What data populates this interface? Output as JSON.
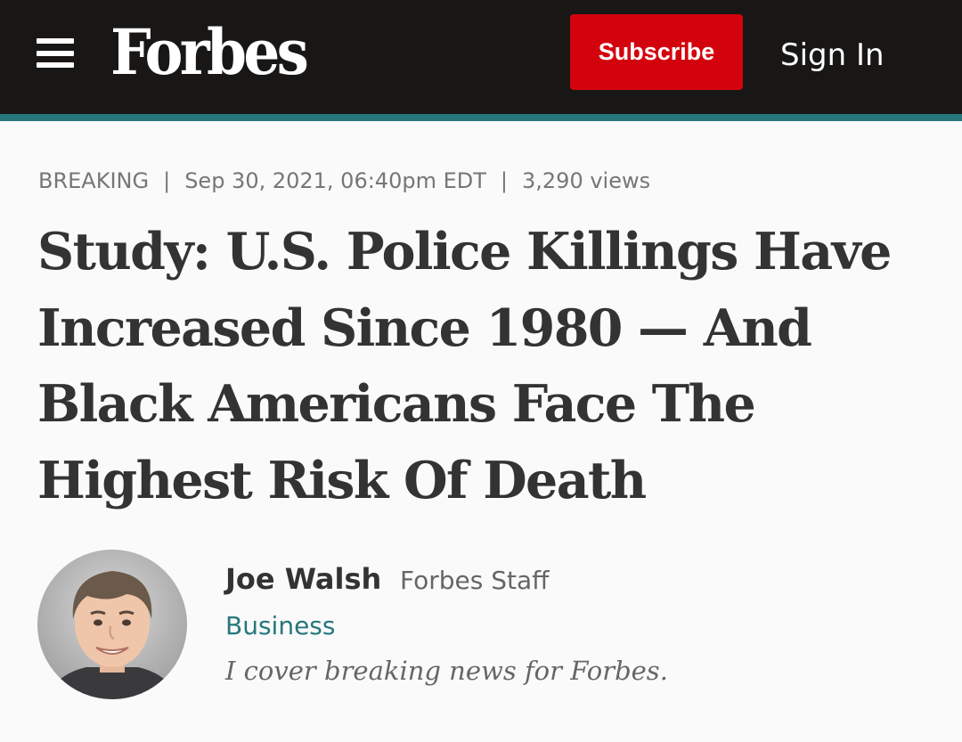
{
  "header": {
    "logo_text": "Forbes",
    "subscribe_label": "Subscribe",
    "signin_label": "Sign In",
    "menu_icon": "hamburger-menu-icon",
    "colors": {
      "bar": "#181716",
      "accent": "#26787c",
      "subscribe": "#d3030d"
    }
  },
  "article": {
    "label": "BREAKING",
    "date": "Sep 30, 2021, 06:40pm EDT",
    "views": "3,290 views",
    "separator": "|",
    "headline": "Study: U.S. Police Killings Have Increased Since 1980 — And Black Americans Face The Highest Risk Of Death"
  },
  "author": {
    "name": "Joe Walsh",
    "type": "Forbes Staff",
    "channel": "Business",
    "bio": "I cover breaking news for Forbes.",
    "colors": {
      "channel": "#26787c"
    }
  }
}
